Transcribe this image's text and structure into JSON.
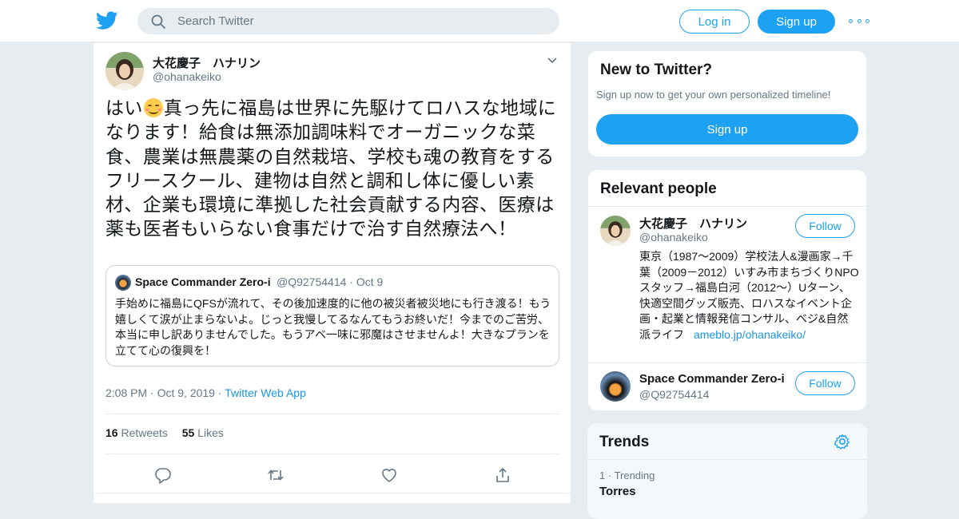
{
  "header": {
    "search_placeholder": "Search Twitter",
    "login_label": "Log in",
    "signup_label": "Sign up"
  },
  "tweet": {
    "author_name": "大花慶子　ハナリン",
    "author_handle": "@ohanakeiko",
    "text_before_emoji": "はい",
    "text_after_emoji": "真っ先に福島は世界に先駆けてロハスな地域になります！給食は無添加調味料でオーガニックな菜食、農業は無農薬の自然栽培、学校も魂の教育をするフリースクール、建物は自然と調和し体に優しい素材、企業も環境に準拠した社会貢献する内容、医療は薬も医者もいらない食事だけで治す自然療法へ！",
    "quote": {
      "author_name": "Space Commander Zero-i",
      "author_handle": "@Q92754414",
      "date": "Oct 9",
      "text": "手始めに福島にQFSが流れて、その後加速度的に他の被災者被災地にも行き渡る！もう嬉しくて涙が止まらないよ。じっと我慢してるなんてもうお終いだ！今までのご苦労、本当に申し訳ありませんでした。もうアベ一味に邪魔はさせませんよ！大きなプランを立てて心の復興を！"
    },
    "time": "2:08 PM",
    "date": "Oct 9, 2019",
    "source": "Twitter Web App",
    "retweets_count": "16",
    "retweets_label": "Retweets",
    "likes_count": "55",
    "likes_label": "Likes"
  },
  "sidebar": {
    "new_to_twitter": {
      "title": "New to Twitter?",
      "subtitle": "Sign up now to get your own personalized timeline!",
      "button": "Sign up"
    },
    "relevant_people": {
      "title": "Relevant people",
      "people": [
        {
          "name": "大花慶子　ハナリン",
          "handle": "@ohanakeiko",
          "follow_label": "Follow",
          "bio": "東京（1987～2009）学校法人&漫画家→千葉（2009－2012）いすみ市まちづくりNPOスタッフ→福島白河（2012～）Uターン、快適空間グッズ販売、ロハスなイベント企画・起業と情報発信コンサル、ベジ&自然派ライフ",
          "bio_link": "ameblo.jp/ohanakeiko/"
        },
        {
          "name": "Space Commander Zero-i",
          "handle": "@Q92754414",
          "follow_label": "Follow"
        }
      ]
    },
    "trends": {
      "title": "Trends",
      "items": [
        {
          "rank": "1",
          "meta": "Trending",
          "name": "Torres"
        }
      ]
    }
  },
  "colors": {
    "accent": "#1da1f2",
    "link": "#1b95e0",
    "muted": "#657786",
    "page_bg": "#e6ecf0"
  },
  "icons": [
    "twitter-bird-icon",
    "search-icon",
    "more-icon",
    "chevron-down-icon",
    "reply-icon",
    "retweet-icon",
    "like-icon",
    "share-icon",
    "gear-icon"
  ]
}
